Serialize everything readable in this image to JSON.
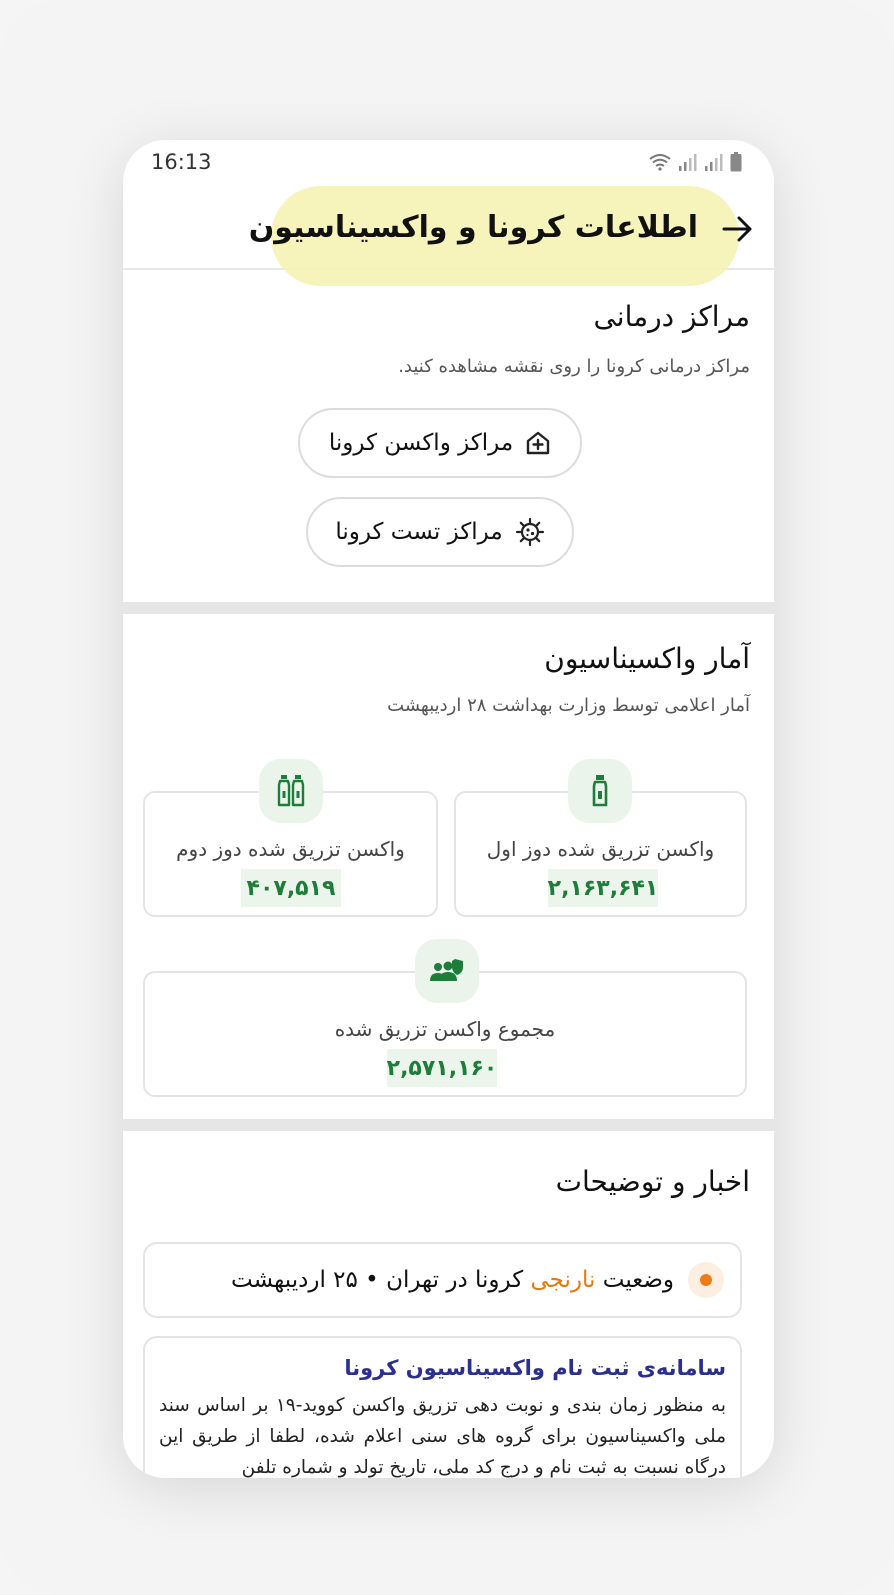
{
  "status_bar": {
    "time": "16:13",
    "icons": [
      "wifi-icon",
      "signal-icon",
      "signal-icon",
      "battery-icon"
    ]
  },
  "app_bar": {
    "title": "اطلاعات کرونا و واکسیناسیون",
    "back_icon": "arrow-right-icon",
    "highlight_color": "#f6f3b4"
  },
  "treatment_centers": {
    "title": "مراکز درمانی",
    "subtitle": "مراکز درمانی کرونا را روی نقشه مشاهده کنید.",
    "buttons": [
      {
        "label": "مراکز واکسن کرونا",
        "icon": "hospital-plus-icon"
      },
      {
        "label": "مراکز تست کرونا",
        "icon": "virus-icon"
      }
    ]
  },
  "vaccination_stats": {
    "title": "آمار واکسیناسیون",
    "subtitle": "آمار اعلامی توسط وزارت بهداشت ۲۸ اردیبهشت",
    "cards": [
      {
        "label": "واکسن تزریق شده دوز اول",
        "value": "۲,۱۶۳,۶۴۱",
        "icon": "vaccine-vial-icon"
      },
      {
        "label": "واکسن تزریق شده دوز دوم",
        "value": "۴۰۷,۵۱۹",
        "icon": "vaccine-vials-icon"
      },
      {
        "label": "مجموع واکسن تزریق شده",
        "value": "۲,۵۷۱,۱۶۰",
        "icon": "people-shield-icon"
      }
    ],
    "value_color": "#1e7d3a"
  },
  "news": {
    "title": "اخبار و توضیحات",
    "status": {
      "prefix": "وضعیت",
      "level": "نارنجی",
      "suffix": "کرونا در تهران • ۲۵ اردیبهشت",
      "level_color": "#e47a11"
    },
    "article": {
      "heading": "سامانه‌ی ثبت نام واکسیناسیون کرونا",
      "body": "به منظور زمان بندی و نوبت دهی تزریق واکسن کووید-۱۹ بر اساس سند ملی واکسیناسیون برای گروه های سنی اعلام شده، لطفا از طریق این درگاه نسبت به ثبت نام و درج کد ملی، تاریخ تولد و شماره تلفن"
    }
  }
}
